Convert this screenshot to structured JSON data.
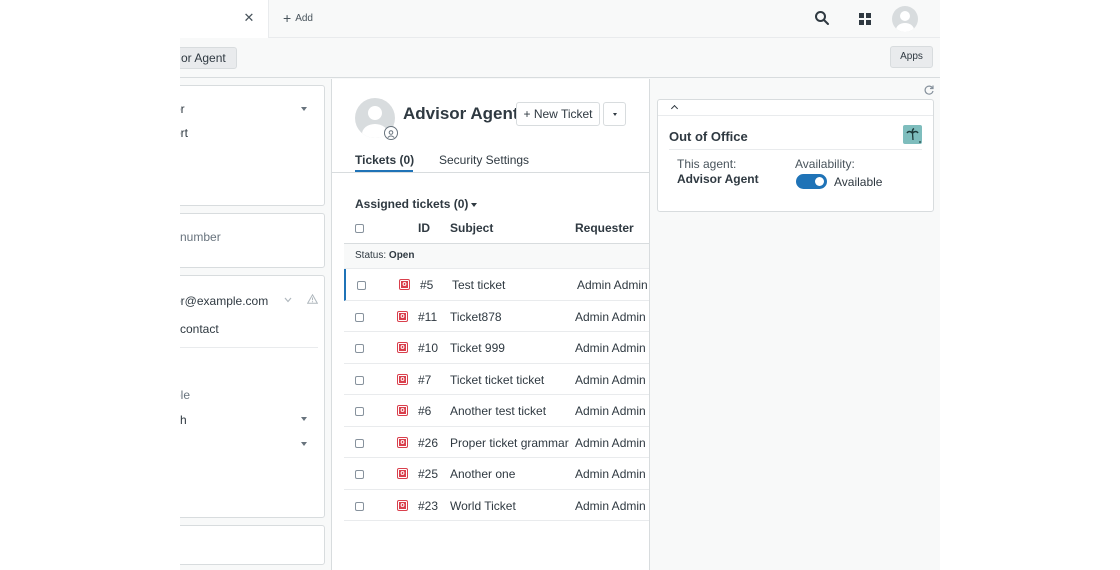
{
  "colors": {
    "accent": "#1f73b7",
    "status_open": "#d93f4c",
    "app_logo": "#7ebdbd"
  },
  "header": {
    "active_tab_close_icon": "close-icon",
    "add_tab_label": "Add",
    "search_icon": "search-icon",
    "apps_grid_icon": "grid-icon"
  },
  "subbar": {
    "breadcrumb": "or Agent",
    "apps_label": "Apps"
  },
  "left_panel": {
    "role_value": "or",
    "group_value": "ort",
    "phone_placeholder": "l number",
    "email_value": "or@example.com",
    "add_contact": "l contact",
    "language_label": "ple",
    "language_value": "sh"
  },
  "user": {
    "name": "Advisor Agent",
    "new_ticket_label": "+ New Ticket"
  },
  "tabs": [
    {
      "label": "Tickets (0)",
      "active": true
    },
    {
      "label": "Security Settings",
      "active": false
    }
  ],
  "tickets": {
    "section_title": "Assigned tickets (0)",
    "columns": {
      "id": "ID",
      "subject": "Subject",
      "requester": "Requester"
    },
    "status_label": "Status:",
    "status_value": "Open",
    "status_badge": "o",
    "rows": [
      {
        "id": "#5",
        "subject": "Test ticket",
        "requester": "Admin Admin"
      },
      {
        "id": "#11",
        "subject": "Ticket878",
        "requester": "Admin Admin"
      },
      {
        "id": "#10",
        "subject": "Ticket 999",
        "requester": "Admin Admin"
      },
      {
        "id": "#7",
        "subject": "Ticket ticket ticket",
        "requester": "Admin Admin"
      },
      {
        "id": "#6",
        "subject": "Another test ticket",
        "requester": "Admin Admin"
      },
      {
        "id": "#26",
        "subject": "Proper ticket grammar",
        "requester": "Admin Admin"
      },
      {
        "id": "#25",
        "subject": "Another one",
        "requester": "Admin Admin"
      },
      {
        "id": "#23",
        "subject": "World Ticket",
        "requester": "Admin Admin"
      }
    ]
  },
  "out_of_office": {
    "title": "Out of Office",
    "agent_label": "This agent:",
    "agent_name": "Advisor Agent",
    "availability_label": "Availability:",
    "availability_value": "Available",
    "available": true
  }
}
